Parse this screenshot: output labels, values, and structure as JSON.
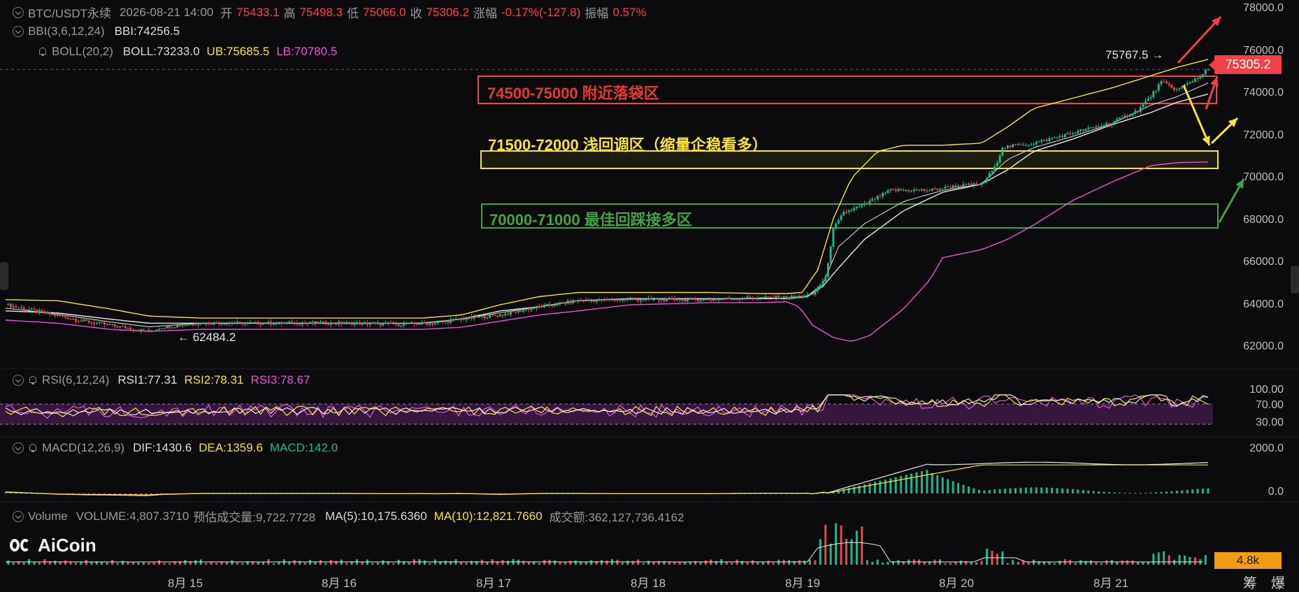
{
  "header": {
    "symbol": "BTC/USDT永续",
    "datetime": "2026-08-21 14:00",
    "open_label": "开",
    "open": "75433.1",
    "high_label": "高",
    "high": "75498.3",
    "low_label": "低",
    "low": "75066.0",
    "close_label": "收",
    "close": "75306.2",
    "change_label": "涨幅",
    "change": "-0.17%(-127.8)",
    "amplitude_label": "振幅",
    "amplitude": "0.57%"
  },
  "indicators": {
    "bbi": {
      "name": "BBI(3,6,12,24)",
      "value": "BBI:74256.5"
    },
    "boll": {
      "name": "BOLL(20,2)",
      "mid": "BOLL:73233.0",
      "ub": "UB:75685.5",
      "lb": "LB:70780.5"
    },
    "rsi": {
      "name": "RSI(6,12,24)",
      "rsi1": "RSI1:77.31",
      "rsi2": "RSI2:78.31",
      "rsi3": "RSI3:78.67"
    },
    "macd": {
      "name": "MACD(12,26,9)",
      "dif": "DIF:1430.6",
      "dea": "DEA:1359.6",
      "macd": "MACD:142.0"
    },
    "volume": {
      "name": "Volume",
      "volume": "VOLUME:4,807.3710",
      "est": "预估成交量:9,722.7728",
      "ma5": "MA(5):10,175.6360",
      "ma10": "MA(10):12,821.7660",
      "turnover": "成交额:362,127,736.4162"
    }
  },
  "zones": [
    {
      "label": "74500-75000 附近落袋区",
      "color": "#e53935"
    },
    {
      "label": "71500-72000 浅回调区（缩量企稳看多）",
      "color": "#f5e23c"
    },
    {
      "label": "70000-71000 最佳回踩接多区",
      "color": "#43a047"
    }
  ],
  "annotations": {
    "high_mark": "75767.5 →",
    "low_mark": "← 62484.2"
  },
  "price_tag": "75305.2",
  "volume_tag": "4.8k",
  "logo": "AiCoin",
  "bottom_right": {
    "a": "筹",
    "b": "爆"
  },
  "colors": {
    "up": "#22b58a",
    "down": "#f0454a",
    "bg": "#0b0b0d",
    "boll_mid": "#e8e8e8",
    "boll_ub": "#f5e23c",
    "boll_lb": "#e455d3"
  },
  "chart_data": {
    "type": "candlestick",
    "y_ticks": [
      "78000.0",
      "76000.0",
      "74000.0",
      "72000.0",
      "70000.0",
      "68000.0",
      "66000.0",
      "64000.0",
      "62000.0"
    ],
    "ylim": [
      61000,
      78700
    ],
    "x_ticks": [
      "8月 15",
      "8月 16",
      "8月 17",
      "8月 18",
      "8月 19",
      "8月 20",
      "8月 21"
    ],
    "price_series": {
      "close": [
        [
          0,
          63800
        ],
        [
          15,
          63400
        ],
        [
          30,
          63000
        ],
        [
          45,
          62700
        ],
        [
          55,
          62500
        ],
        [
          60,
          62700
        ],
        [
          75,
          62900
        ],
        [
          100,
          62900
        ],
        [
          130,
          62900
        ],
        [
          150,
          62850
        ],
        [
          165,
          62900
        ],
        [
          175,
          63100
        ],
        [
          190,
          63300
        ],
        [
          205,
          63700
        ],
        [
          220,
          64000
        ],
        [
          240,
          64050
        ],
        [
          270,
          64050
        ],
        [
          290,
          64150
        ],
        [
          300,
          64150
        ],
        [
          305,
          64200
        ],
        [
          310,
          64300
        ],
        [
          315,
          65100
        ],
        [
          318,
          67500
        ],
        [
          322,
          68300
        ],
        [
          330,
          68700
        ],
        [
          340,
          69400
        ],
        [
          355,
          69400
        ],
        [
          365,
          69600
        ],
        [
          375,
          69700
        ],
        [
          380,
          70500
        ],
        [
          383,
          71500
        ],
        [
          395,
          71700
        ],
        [
          410,
          72200
        ],
        [
          425,
          72700
        ],
        [
          435,
          73300
        ],
        [
          440,
          74000
        ],
        [
          444,
          74700
        ],
        [
          450,
          74300
        ],
        [
          458,
          74900
        ],
        [
          462,
          75306
        ]
      ]
    },
    "boll_ub": [
      [
        0,
        64050
      ],
      [
        20,
        64000
      ],
      [
        40,
        63600
      ],
      [
        55,
        63250
      ],
      [
        75,
        63150
      ],
      [
        100,
        63150
      ],
      [
        130,
        63150
      ],
      [
        160,
        63150
      ],
      [
        175,
        63300
      ],
      [
        190,
        63800
      ],
      [
        205,
        64200
      ],
      [
        220,
        64400
      ],
      [
        240,
        64400
      ],
      [
        270,
        64400
      ],
      [
        290,
        64350
      ],
      [
        300,
        64350
      ],
      [
        306,
        64400
      ],
      [
        312,
        65500
      ],
      [
        318,
        68000
      ],
      [
        325,
        70000
      ],
      [
        335,
        71300
      ],
      [
        345,
        71600
      ],
      [
        360,
        71600
      ],
      [
        375,
        71700
      ],
      [
        385,
        72500
      ],
      [
        395,
        73400
      ],
      [
        410,
        73900
      ],
      [
        425,
        74400
      ],
      [
        440,
        75000
      ],
      [
        450,
        75400
      ],
      [
        462,
        75800
      ]
    ],
    "boll_mid": [
      [
        0,
        63500
      ],
      [
        20,
        63400
      ],
      [
        40,
        63100
      ],
      [
        55,
        62900
      ],
      [
        75,
        62900
      ],
      [
        100,
        62900
      ],
      [
        130,
        62900
      ],
      [
        160,
        62900
      ],
      [
        175,
        63100
      ],
      [
        190,
        63500
      ],
      [
        205,
        63700
      ],
      [
        220,
        64000
      ],
      [
        240,
        64100
      ],
      [
        270,
        64100
      ],
      [
        290,
        64100
      ],
      [
        300,
        64100
      ],
      [
        308,
        64200
      ],
      [
        314,
        64700
      ],
      [
        320,
        65600
      ],
      [
        330,
        67000
      ],
      [
        345,
        68400
      ],
      [
        360,
        69300
      ],
      [
        375,
        69700
      ],
      [
        385,
        70400
      ],
      [
        395,
        71300
      ],
      [
        410,
        71900
      ],
      [
        425,
        72600
      ],
      [
        440,
        73200
      ],
      [
        450,
        73700
      ],
      [
        462,
        74100
      ]
    ],
    "boll_lb": [
      [
        0,
        63050
      ],
      [
        20,
        62900
      ],
      [
        40,
        62600
      ],
      [
        55,
        62500
      ],
      [
        75,
        62600
      ],
      [
        100,
        62600
      ],
      [
        130,
        62600
      ],
      [
        160,
        62600
      ],
      [
        175,
        62700
      ],
      [
        190,
        63000
      ],
      [
        205,
        63300
      ],
      [
        220,
        63500
      ],
      [
        240,
        63800
      ],
      [
        270,
        63900
      ],
      [
        290,
        63900
      ],
      [
        300,
        63950
      ],
      [
        305,
        63700
      ],
      [
        310,
        62800
      ],
      [
        318,
        62200
      ],
      [
        325,
        62000
      ],
      [
        332,
        62300
      ],
      [
        345,
        63600
      ],
      [
        355,
        65000
      ],
      [
        360,
        66100
      ],
      [
        375,
        66500
      ],
      [
        385,
        67000
      ],
      [
        395,
        67700
      ],
      [
        410,
        68900
      ],
      [
        425,
        69800
      ],
      [
        440,
        70600
      ],
      [
        450,
        70750
      ],
      [
        462,
        70780
      ]
    ],
    "rsi": {
      "levels": [
        "100.00",
        "70.00",
        "30.00"
      ],
      "last": [
        77.31,
        78.31,
        78.67
      ]
    },
    "macd": {
      "levels": [
        "2000.0",
        "0.0"
      ],
      "dif": 1430.6,
      "dea": 1359.6,
      "hist": 142.0
    },
    "volume_last": 4807.371
  }
}
